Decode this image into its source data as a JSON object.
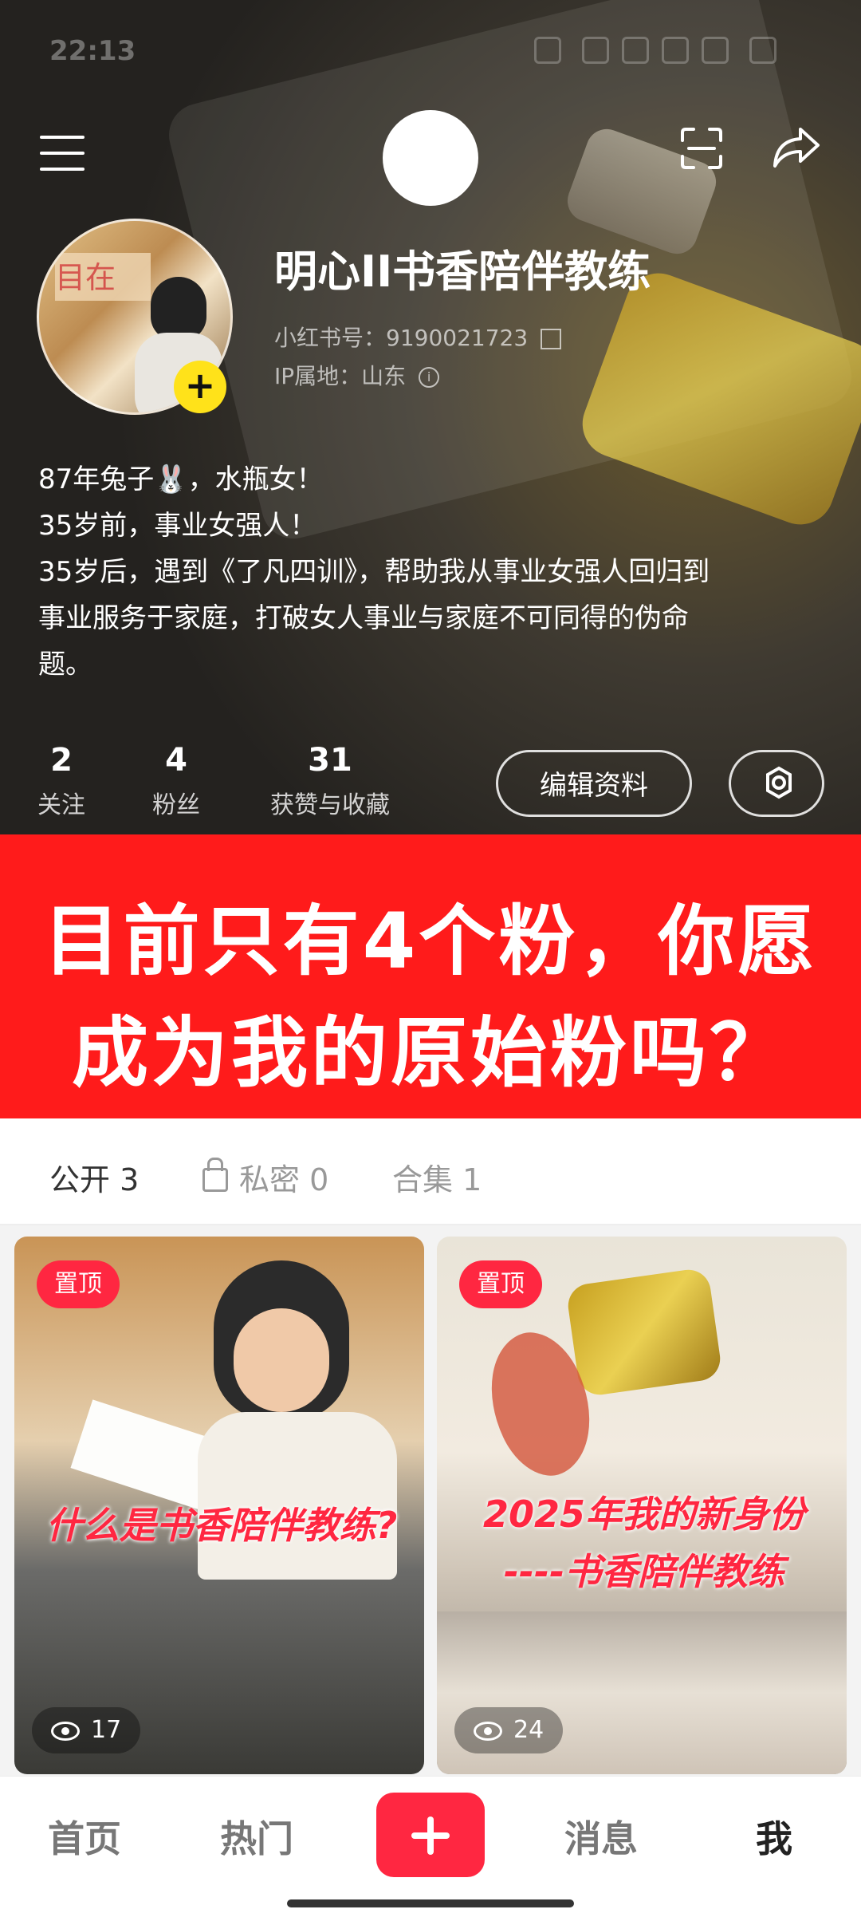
{
  "statusbar": {
    "time": "22:13"
  },
  "profile": {
    "name": "明心II书香陪伴教练",
    "id_label": "小红书号：9190021723",
    "ip_label": "IP属地：山东",
    "avatar_sign": "目在"
  },
  "bio": [
    "87年兔子🐰，水瓶女！",
    "35岁前，事业女强人！",
    "35岁后，遇到《了凡四训》，帮助我从事业女强人回归到",
    "事业服务于家庭，打破女人事业与家庭不可同得的伪命",
    "题。"
  ],
  "stats": [
    {
      "num": "2",
      "label": "关注"
    },
    {
      "num": "4",
      "label": "粉丝"
    },
    {
      "num": "31",
      "label": "获赞与收藏"
    }
  ],
  "buttons": {
    "edit": "编辑资料"
  },
  "banner": {
    "line1": "目前只有4个粉，你愿",
    "line2": "成为我的原始粉吗？"
  },
  "tabs": {
    "public": "公开 3",
    "private": "私密 0",
    "collection": "合集 1"
  },
  "cards": [
    {
      "pin": "置顶",
      "overlay1": "什么是书香陪伴教练?",
      "overlay2": "",
      "views": "17"
    },
    {
      "pin": "置顶",
      "overlay1": "2025年我的新身份",
      "overlay2": "----书香陪伴教练",
      "views": "24"
    }
  ],
  "nav": {
    "home": "首页",
    "hot": "热门",
    "messages": "消息",
    "me": "我"
  }
}
